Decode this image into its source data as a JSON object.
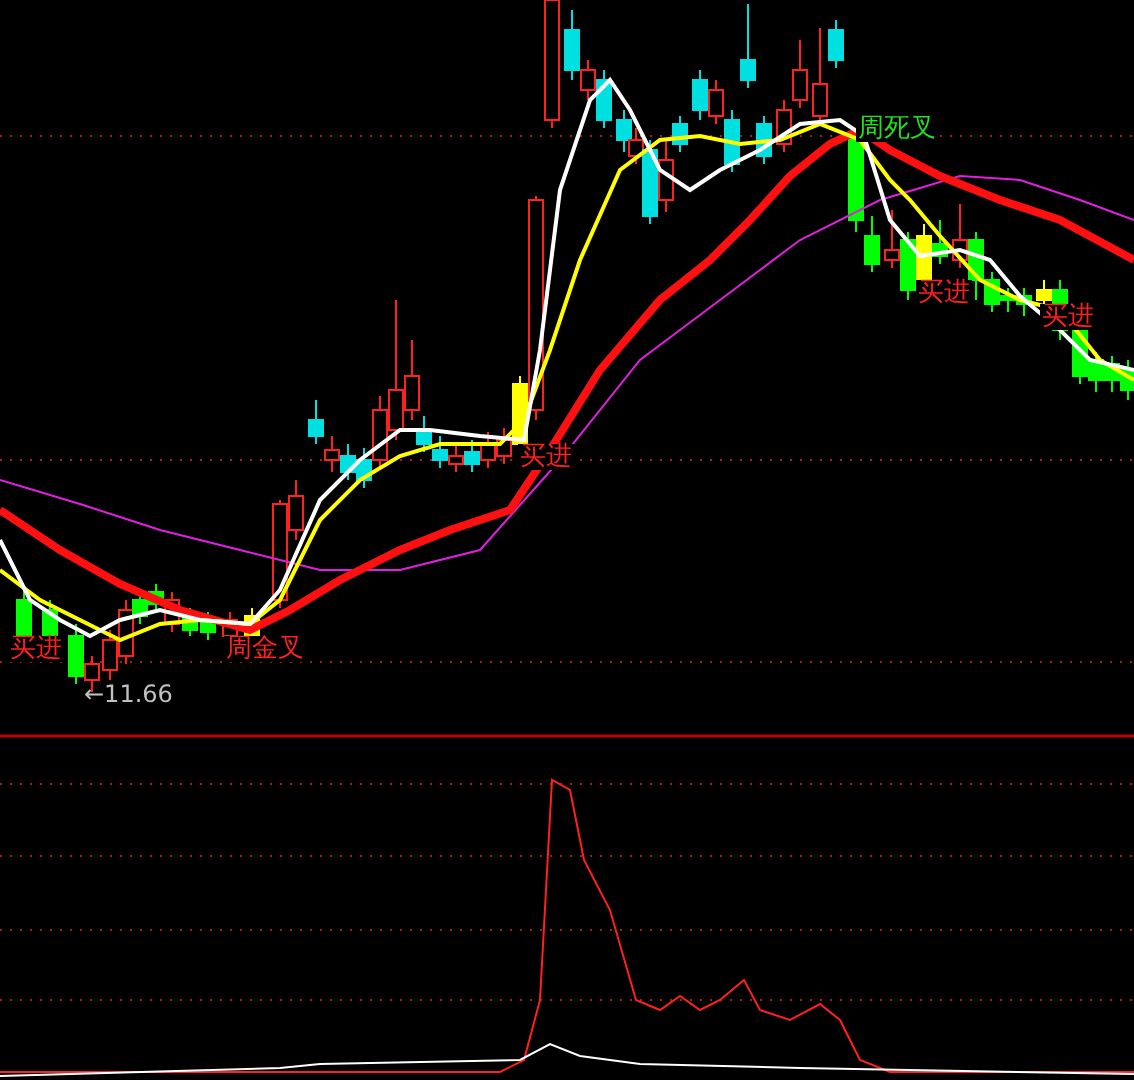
{
  "main_chart": {
    "signals": [
      {
        "text": "买进",
        "color": "#ff2020"
      },
      {
        "text": "周金叉",
        "color": "#ff2020"
      },
      {
        "text": "买进",
        "color": "#ff2020"
      },
      {
        "text": "周死叉",
        "color": "#20e020"
      },
      {
        "text": "买进",
        "color": "#ff2020"
      },
      {
        "text": "买进",
        "color": "#ff2020"
      }
    ],
    "low_price_marker": "←11.66"
  }
}
